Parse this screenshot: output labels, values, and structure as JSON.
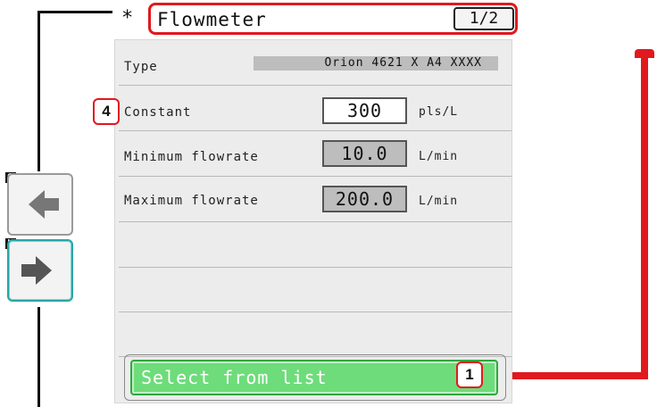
{
  "header": {
    "asterisk": "*",
    "title": "Flowmeter",
    "page_indicator": "1/2"
  },
  "fields": {
    "type": {
      "label": "Type",
      "value": "Orion 4621 X A4 XXXX"
    },
    "constant": {
      "label": "Constant",
      "value": "300",
      "unit": "pls/L"
    },
    "min_flow": {
      "label": "Minimum flowrate",
      "value": "10.0",
      "unit": "L/min"
    },
    "max_flow": {
      "label": "Maximum flowrate",
      "value": "200.0",
      "unit": "L/min"
    }
  },
  "select_button": {
    "label": "Select from list"
  },
  "badges": {
    "constant": "4",
    "select": "1"
  },
  "side_keys": {
    "back": {
      "key": "G",
      "icon": "arrow-left-icon"
    },
    "forward": {
      "key": "H",
      "icon": "arrow-right-icon"
    }
  },
  "colors": {
    "callout_red": "#e0191f",
    "select_green": "#6edc7a",
    "panel_bg": "#ececec",
    "readonly_gray": "#bdbdbd",
    "active_teal": "#2aa6a6"
  }
}
